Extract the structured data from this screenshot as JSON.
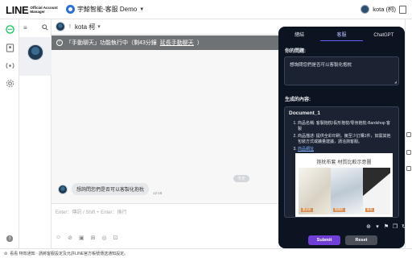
{
  "brand": {
    "logo_main": "LINE",
    "logo_sub_line1": "Official Account",
    "logo_sub_line2": "Manager"
  },
  "account": {
    "name": "宇鯨智能-客服 Demo"
  },
  "user": {
    "name": "kota (柯)"
  },
  "chat": {
    "contact_name": "kota 柯",
    "banner_text": "「手動聊天」功能執行中（剩43分鐘",
    "banner_link": "延長手動聊天",
    "banner_close": "）",
    "date_divider": "今天",
    "message_text": "想詢問您們是否可以客製化抱枕",
    "message_time": "12:18",
    "input_placeholder": "Enter：傳訊 / Shift + Enter：換行"
  },
  "bottom_notice": "看看 特效通知 · 請將客服設定及允許LINE官方帳號傳送通知設定。",
  "panel": {
    "tabs": [
      "總結",
      "客服",
      "ChatGPT"
    ],
    "active_tab": 1,
    "question_label": "你的問題:",
    "question_text": "想詢問您們是否可以客製化抱枕",
    "result_label": "生成的內容:",
    "doc_title": "Document_1",
    "items": [
      "商品名稱: 客製抱枕/長形抱枕/零身抱枕-Bardshop 客製",
      "商品描述: 提供全彩印刷，擁至少訂購1件，如需其他包裝方式或擴量建議，請洽詢客服。",
      "商品網址"
    ],
    "product_image_title": "抱枕布套 材質比較示意圖",
    "fabric_tags": [
      "柔光布",
      "短絨布",
      "帆布"
    ],
    "submit_label": "Submit",
    "reset_label": "Reset"
  },
  "colors": {
    "line_green": "#06c755",
    "panel_bg": "#0d1421",
    "submit_purple": "#6f3fd8",
    "banner_gray": "#6f7275"
  }
}
